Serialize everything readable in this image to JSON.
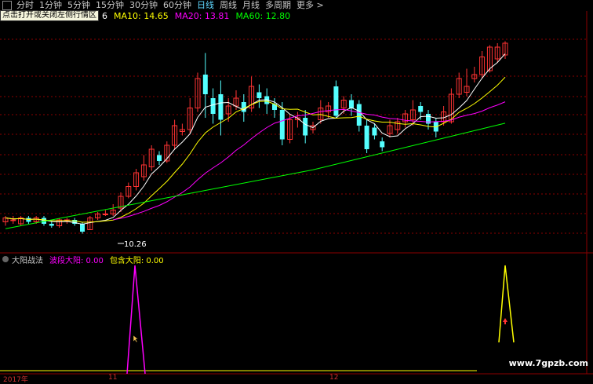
{
  "toolbar": {
    "items": [
      "分时",
      "1分钟",
      "5分钟",
      "15分钟",
      "30分钟",
      "60分钟",
      "日线",
      "周线",
      "月线",
      "多周期",
      "更多 >"
    ],
    "active_index": 6
  },
  "tooltip": "点击打开或关闭左侧行情区",
  "ma": {
    "ma5_tail": "6",
    "ma10": "MA10: 14.65",
    "ma20": "MA20: 13.81",
    "ma60": "MA60: 12.80"
  },
  "low_label": "10.26",
  "indicator": {
    "name": "大阳战法",
    "line1": "波段大阳: 0.00",
    "line2": "包含大阳: 0.00"
  },
  "watermark": "www.7gpzb.com",
  "xaxis": {
    "labels": [
      "2017年",
      "11",
      "12"
    ]
  },
  "colors": {
    "up": "#ff3333",
    "down": "#54ffff",
    "ma5": "#ffffff",
    "ma10": "#ffff00",
    "ma20": "#ff00ff",
    "ma60": "#00ff00",
    "grid": "#8b0000"
  }
}
